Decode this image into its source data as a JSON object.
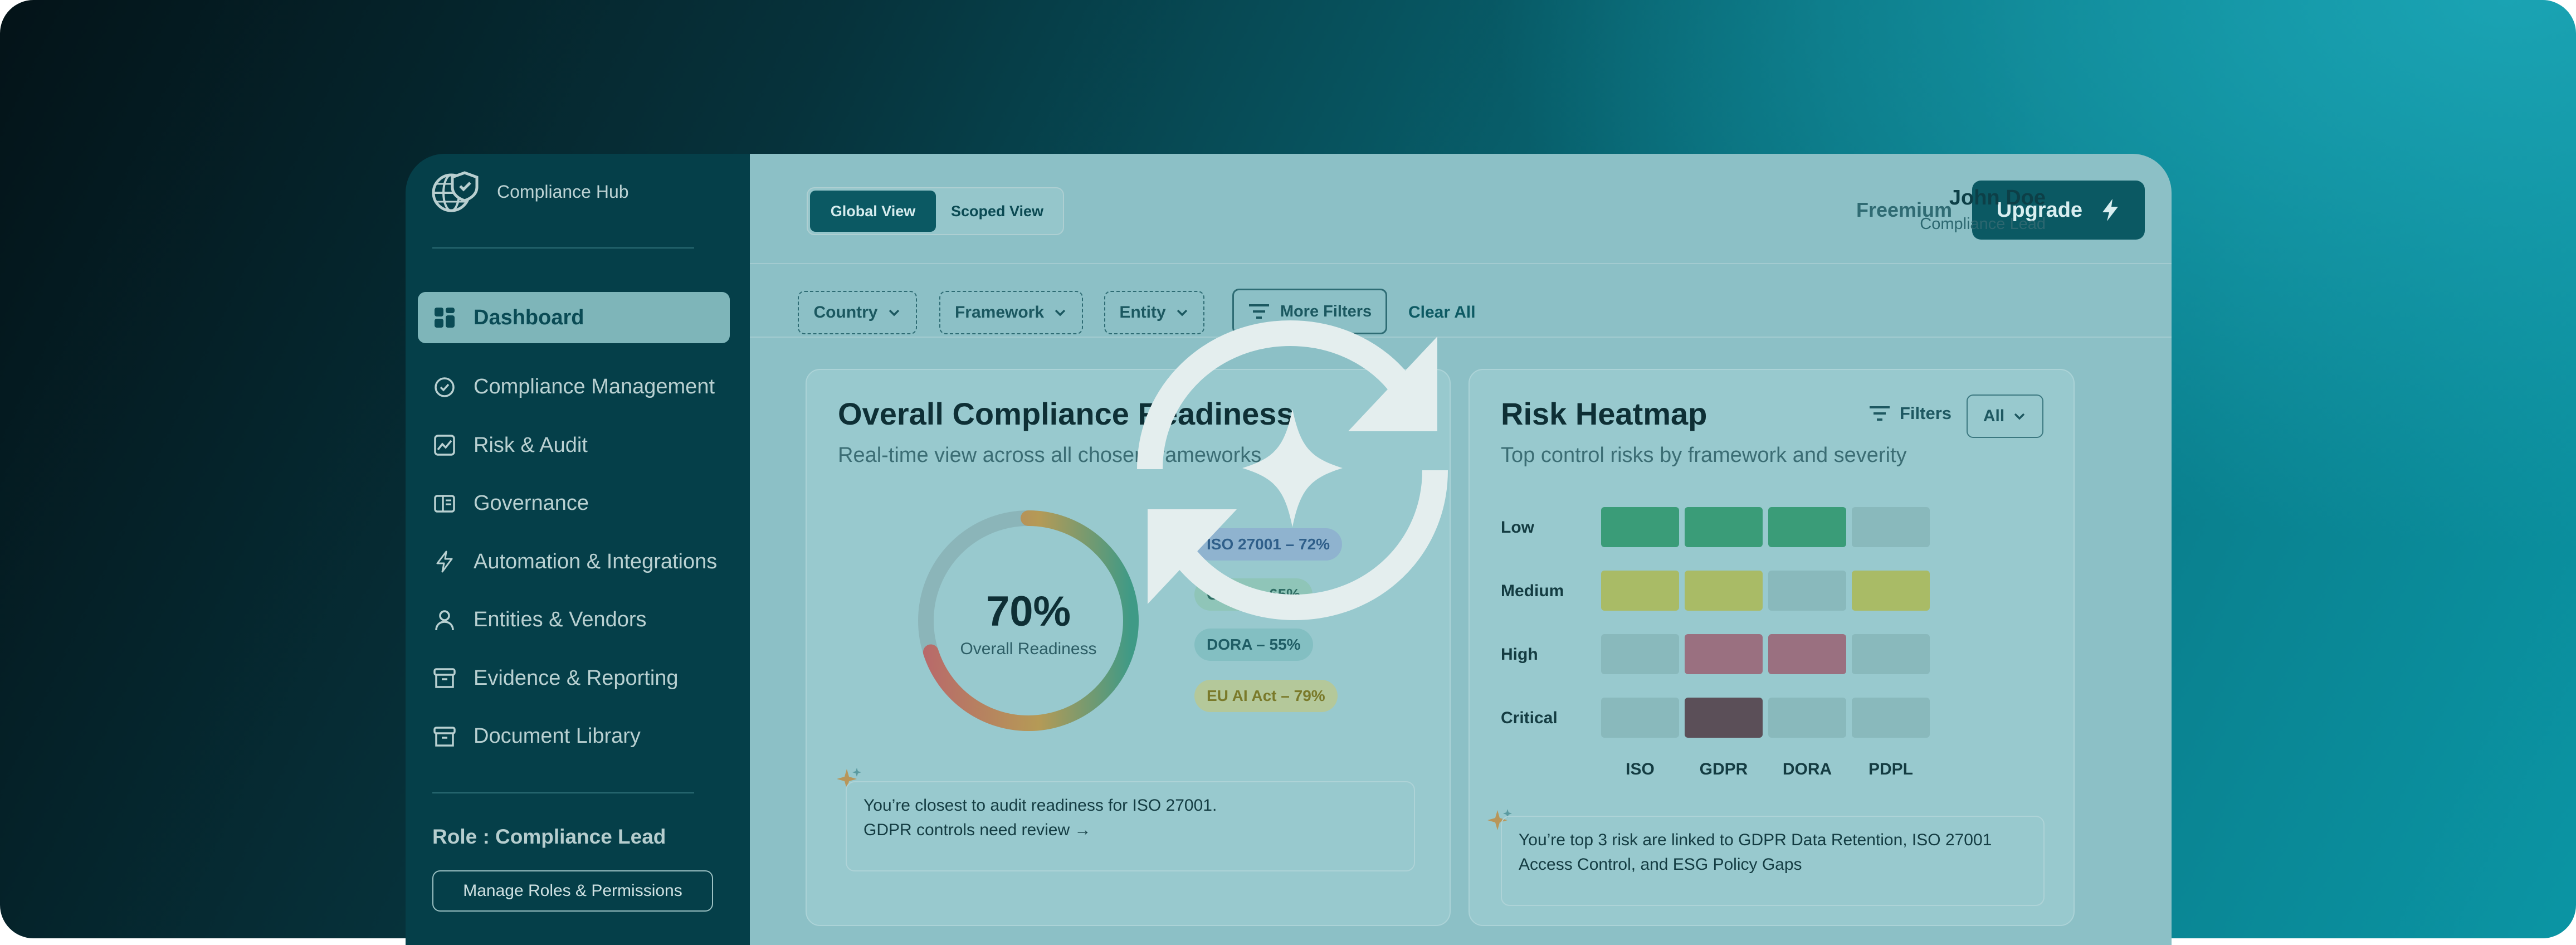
{
  "app": {
    "name": "Compliance Hub"
  },
  "sidebar": {
    "items": [
      {
        "label": "Dashboard",
        "icon": "grid-icon",
        "active": true
      },
      {
        "label": "Compliance Management",
        "icon": "check-circle-icon"
      },
      {
        "label": "Risk & Audit",
        "icon": "chart-icon"
      },
      {
        "label": "Governance",
        "icon": "book-icon"
      },
      {
        "label": "Automation & Integrations",
        "icon": "bolt-icon"
      },
      {
        "label": "Entities & Vendors",
        "icon": "user-icon"
      },
      {
        "label": "Evidence & Reporting",
        "icon": "archive-icon"
      },
      {
        "label": "Document Library",
        "icon": "archive-icon"
      }
    ],
    "role_label": "Role : Compliance Lead",
    "manage_roles_label": "Manage Roles & Permissions"
  },
  "topbar": {
    "view_options": [
      "Global View",
      "Scoped View"
    ],
    "active_view": "Global View",
    "plan_label": "Freemium",
    "upgrade_label": "Upgrade",
    "user_name": "John Doe",
    "user_role": "Compliance Lead"
  },
  "filters": {
    "chips": [
      "Country",
      "Framework",
      "Entity"
    ],
    "more_filters_label": "More Filters",
    "clear_all_label": "Clear All"
  },
  "readiness": {
    "title": "Overall Compliance Readiness",
    "subtitle": "Real-time view across all chosen frameworks",
    "value": "70%",
    "value_fraction": 0.7,
    "value_label": "Overall Readiness",
    "frameworks": [
      {
        "label": "ISO 27001 – 72%",
        "color": "#8fb3cf",
        "text": "#2f5f8a"
      },
      {
        "label": "GDPR – 65%",
        "color": "#8fc5b8",
        "text": "#2f6d64"
      },
      {
        "label": "DORA – 55%",
        "color": "#83bfc2",
        "text": "#1f5d65"
      },
      {
        "label": "EU AI Act – 79%",
        "color": "#b4c89a",
        "text": "#7a7a2a"
      }
    ],
    "insight_line1": "You’re closest to audit readiness for ISO 27001.",
    "insight_line2": "GDPR controls need review",
    "insight_arrow": "→"
  },
  "heatmap": {
    "title": "Risk Heatmap",
    "subtitle": "Top control risks by framework and severity",
    "filter_label": "Filters",
    "select_value": "All",
    "rows": [
      "Low",
      "Medium",
      "High",
      "Critical"
    ],
    "cols": [
      "ISO",
      "GDPR",
      "DORA",
      "PDPL"
    ],
    "cells": [
      [
        "#3a9c78",
        "#3a9c78",
        "#3a9c78",
        "#89b9bc"
      ],
      [
        "#a9bb66",
        "#a9bb66",
        "#89b9bc",
        "#a9bb66"
      ],
      [
        "#89b9bc",
        "#9a7080",
        "#9a7080",
        "#89b9bc"
      ],
      [
        "#89b9bc",
        "#5b4f58",
        "#89b9bc",
        "#89b9bc"
      ]
    ],
    "insight_line1": "You’re top 3 risk are linked to GDPR Data Retention, ISO 27001",
    "insight_line2": "Access Control, and ESG Policy Gaps"
  },
  "overlay": {
    "icon": "refresh-sparkle-icon"
  }
}
